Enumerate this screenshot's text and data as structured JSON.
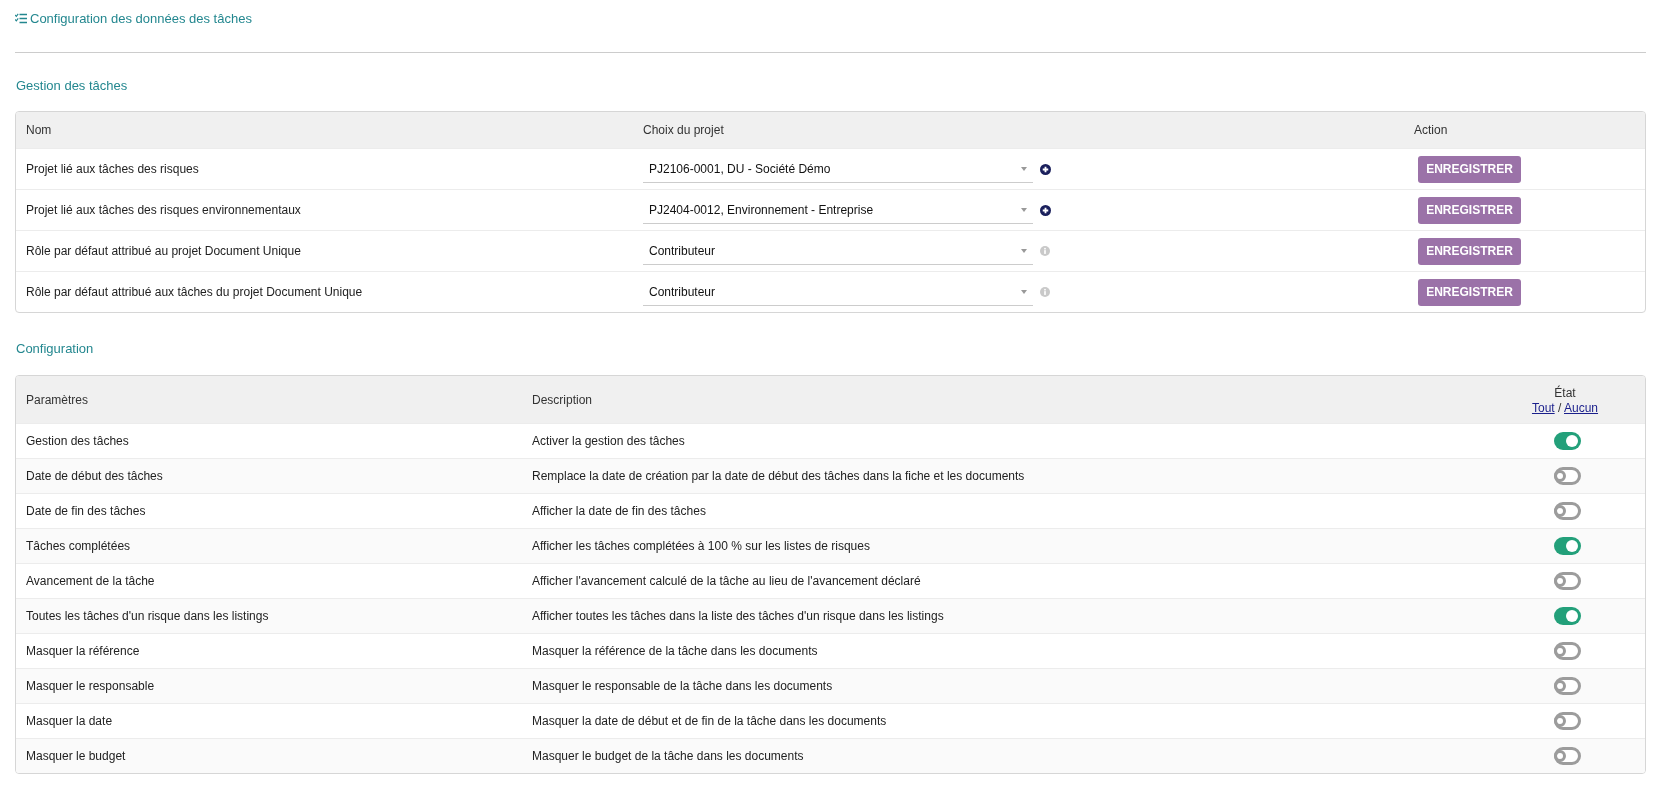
{
  "page_title": "Configuration des données des tâches",
  "task_management": {
    "title": "Gestion des tâches",
    "columns": [
      "Nom",
      "Choix du projet",
      "Action"
    ],
    "rows": [
      {
        "name": "Projet lié aux tâches des risques",
        "value": "PJ2106-0001, DU - Société Démo",
        "kind": "project",
        "button": "ENREGISTRER"
      },
      {
        "name": "Projet lié aux tâches des risques environnementaux",
        "value": "PJ2404-0012, Environnement - Entreprise",
        "kind": "project",
        "button": "ENREGISTRER"
      },
      {
        "name": "Rôle par défaut attribué au projet Document Unique",
        "value": "Contributeur",
        "kind": "role",
        "button": "ENREGISTRER"
      },
      {
        "name": "Rôle par défaut attribué aux tâches du projet Document Unique",
        "value": "Contributeur",
        "kind": "role",
        "button": "ENREGISTRER"
      }
    ]
  },
  "configuration": {
    "title": "Configuration",
    "columns": [
      "Paramètres",
      "Description",
      "État"
    ],
    "select_all": "Tout",
    "separator": "/",
    "select_none": "Aucun",
    "rows": [
      {
        "parameter": "Gestion des tâches",
        "description": "Activer la gestion des tâches",
        "on": true
      },
      {
        "parameter": "Date de début des tâches",
        "description": "Remplace la date de création par la date de début des tâches dans la fiche et les documents",
        "on": false
      },
      {
        "parameter": "Date de fin des tâches",
        "description": "Afficher la date de fin des tâches",
        "on": false
      },
      {
        "parameter": "Tâches complétées",
        "description": "Afficher les tâches complétées à 100 % sur les listes de risques",
        "on": true
      },
      {
        "parameter": "Avancement de la tâche",
        "description": "Afficher l'avancement calculé de la tâche au lieu de l'avancement déclaré",
        "on": false
      },
      {
        "parameter": "Toutes les tâches d'un risque dans les listings",
        "description": "Afficher toutes les tâches dans la liste des tâches d'un risque dans les listings",
        "on": true
      },
      {
        "parameter": "Masquer la référence",
        "description": "Masquer la référence de la tâche dans les documents",
        "on": false
      },
      {
        "parameter": "Masquer le responsable",
        "description": "Masquer le responsable de la tâche dans les documents",
        "on": false
      },
      {
        "parameter": "Masquer la date",
        "description": "Masquer la date de début et de fin de la tâche dans les documents",
        "on": false
      },
      {
        "parameter": "Masquer le budget",
        "description": "Masquer le budget de la tâche dans les documents",
        "on": false
      }
    ]
  }
}
